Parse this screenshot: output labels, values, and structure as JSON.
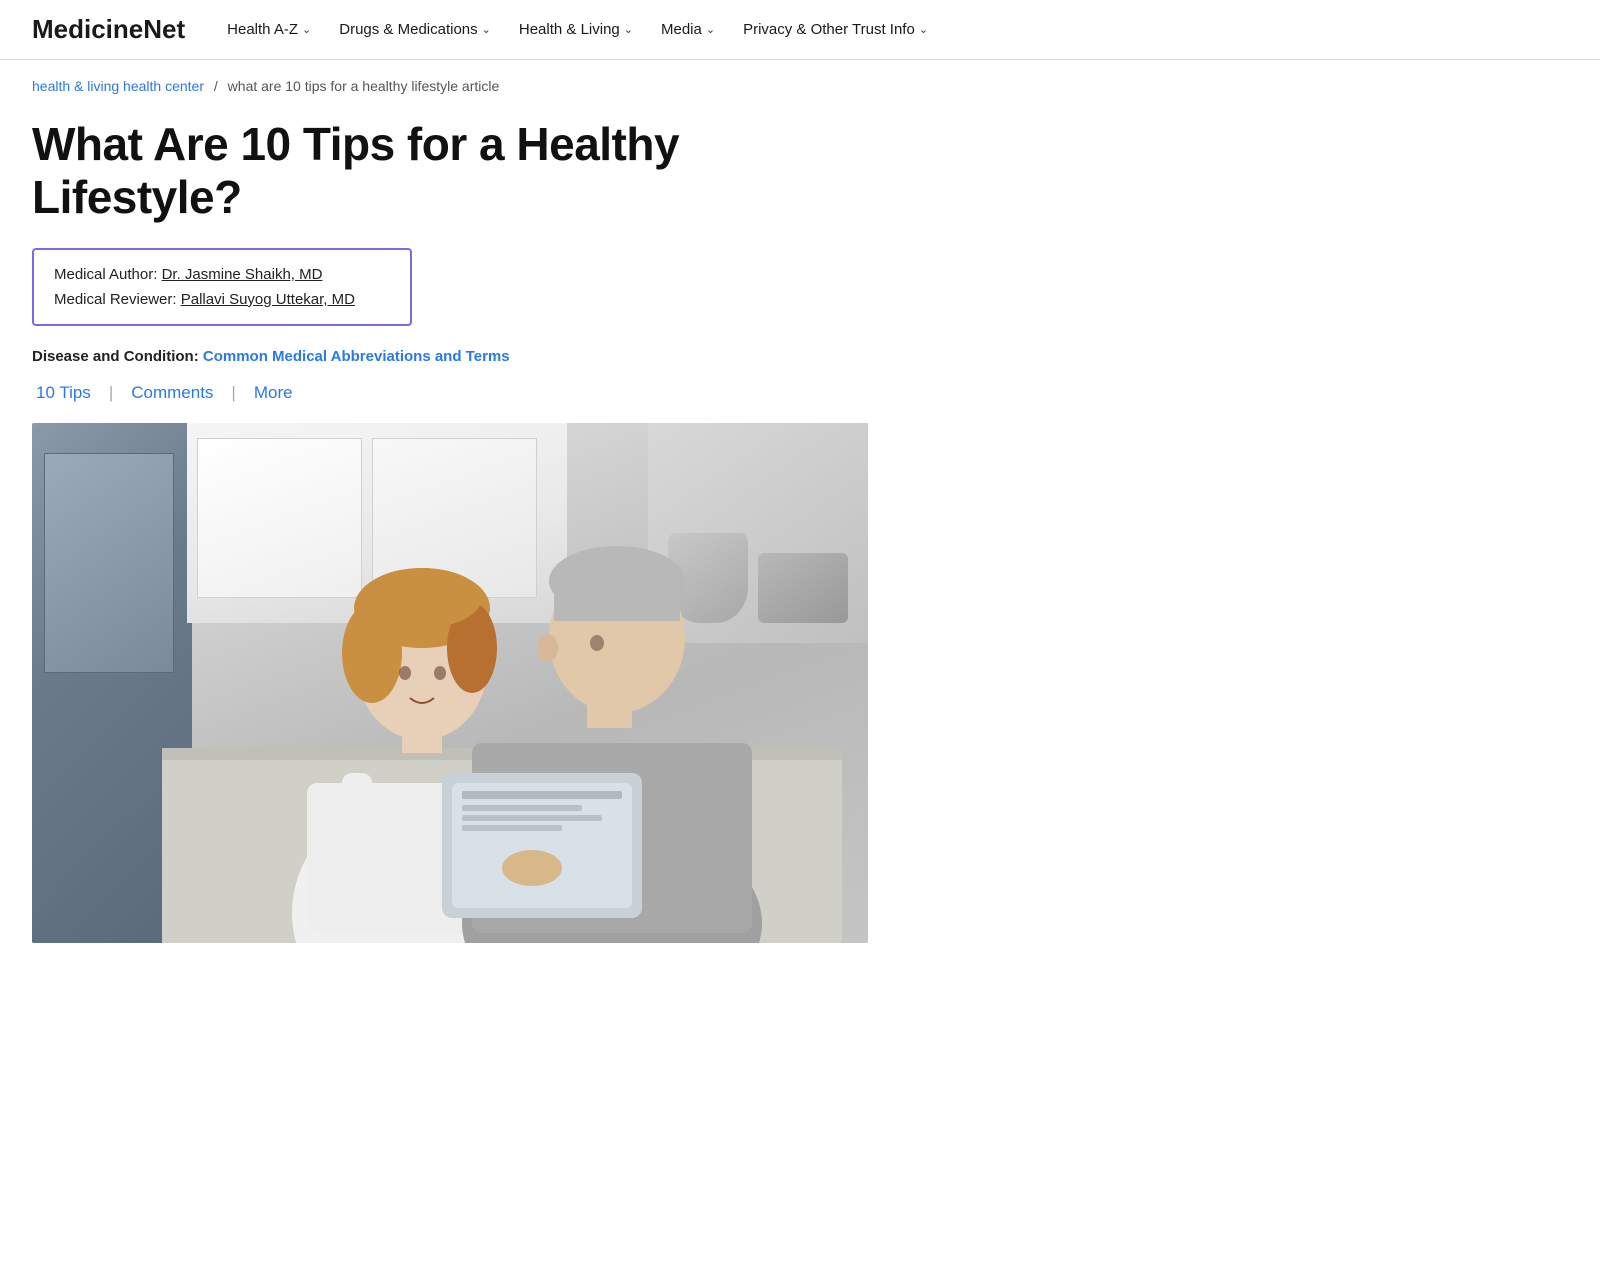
{
  "nav": {
    "logo": "MedicineNet",
    "items": [
      {
        "label": "Health A-Z",
        "id": "health-az"
      },
      {
        "label": "Drugs & Medications",
        "id": "drugs-medications"
      },
      {
        "label": "Health & Living",
        "id": "health-living"
      },
      {
        "label": "Media",
        "id": "media"
      },
      {
        "label": "Privacy & Other Trust Info",
        "id": "privacy"
      }
    ]
  },
  "breadcrumb": {
    "link_text": "health & living health center",
    "separator": "/",
    "current": "what are 10 tips for a healthy lifestyle article"
  },
  "article": {
    "title": "What Are 10 Tips for a Healthy Lifestyle?",
    "author_label": "Medical Author:",
    "author_name": "Dr. Jasmine Shaikh, MD",
    "reviewer_label": "Medical Reviewer:",
    "reviewer_name": "Pallavi Suyog Uttekar, MD",
    "disease_label": "Disease and Condition:",
    "disease_link": "Common Medical Abbreviations and Terms"
  },
  "tabs": [
    {
      "label": "10 Tips",
      "id": "ten-tips"
    },
    {
      "label": "Comments",
      "id": "comments"
    },
    {
      "label": "More",
      "id": "more"
    }
  ],
  "colors": {
    "accent_blue": "#2a7ae4",
    "author_border": "#7b68ee",
    "nav_divider": "#ddd"
  }
}
